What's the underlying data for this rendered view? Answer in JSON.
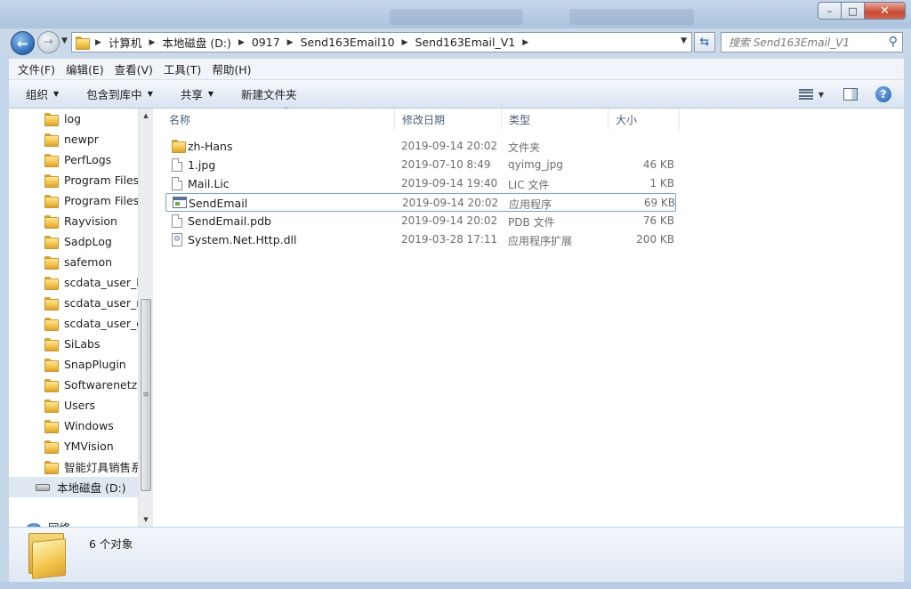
{
  "window": {
    "caption_buttons": {
      "minimize": "–",
      "maximize": "□",
      "close": "✕"
    }
  },
  "address": {
    "breadcrumbs": [
      "计算机",
      "本地磁盘 (D:)",
      "0917",
      "Send163Email10",
      "Send163Email_V1"
    ]
  },
  "search": {
    "placeholder": "搜索 Send163Email_V1"
  },
  "menu": [
    "文件(F)",
    "编辑(E)",
    "查看(V)",
    "工具(T)",
    "帮助(H)"
  ],
  "toolbar": {
    "organize": "组织",
    "include_in_library": "包含到库中",
    "share": "共享",
    "new_folder": "新建文件夹",
    "help": "?"
  },
  "tree": {
    "items": [
      "log",
      "newpr",
      "PerfLogs",
      "Program Files",
      "Program Files",
      "Rayvision",
      "SadpLog",
      "safemon",
      "scdata_user_lc",
      "scdata_user_m",
      "scdata_user_q",
      "SiLabs",
      "SnapPlugin",
      "Softwarenetz",
      "Users",
      "Windows",
      "YMVision",
      "智能灯具销售系"
    ],
    "drive": "本地磁盘 (D:)",
    "network": "网络"
  },
  "columns": {
    "name": "名称",
    "date": "修改日期",
    "type": "类型",
    "size": "大小"
  },
  "files": [
    {
      "name": "zh-Hans",
      "date": "2019-09-14 20:02",
      "type": "文件夹",
      "size": "",
      "icon": "folder-icon"
    },
    {
      "name": "1.jpg",
      "date": "2019-07-10 8:49",
      "type": "qyimg_jpg",
      "size": "46 KB",
      "icon": "file-icon"
    },
    {
      "name": "Mail.Lic",
      "date": "2019-09-14 19:40",
      "type": "LIC 文件",
      "size": "1 KB",
      "icon": "file-icon"
    },
    {
      "name": "SendEmail",
      "date": "2019-09-14 20:02",
      "type": "应用程序",
      "size": "69 KB",
      "icon": "application-icon"
    },
    {
      "name": "SendEmail.pdb",
      "date": "2019-09-14 20:02",
      "type": "PDB 文件",
      "size": "76 KB",
      "icon": "file-icon"
    },
    {
      "name": "System.Net.Http.dll",
      "date": "2019-03-28 17:11",
      "type": "应用程序扩展",
      "size": "200 KB",
      "icon": "dll-icon"
    }
  ],
  "selected_file": "SendEmail",
  "status": {
    "object_count": "6 个对象"
  }
}
